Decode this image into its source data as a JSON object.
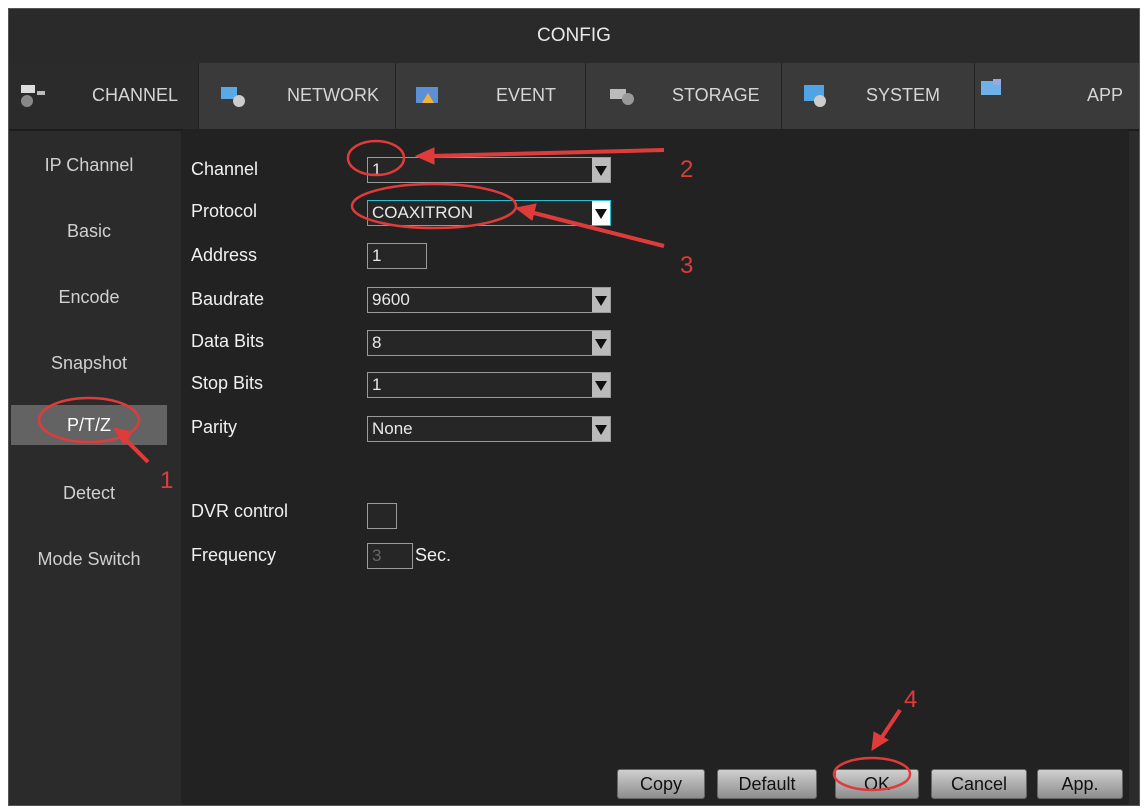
{
  "window": {
    "title": "CONFIG"
  },
  "tabs": [
    {
      "label": "CHANNEL",
      "icon": "channel-icon"
    },
    {
      "label": "NETWORK",
      "icon": "network-icon"
    },
    {
      "label": "EVENT",
      "icon": "event-icon"
    },
    {
      "label": "STORAGE",
      "icon": "storage-icon"
    },
    {
      "label": "SYSTEM",
      "icon": "system-icon"
    },
    {
      "label": "APP",
      "icon": "app-icon"
    }
  ],
  "sidebar": {
    "items": [
      {
        "label": "IP Channel"
      },
      {
        "label": "Basic"
      },
      {
        "label": "Encode"
      },
      {
        "label": "Snapshot"
      },
      {
        "label": "P/T/Z"
      },
      {
        "label": "Detect"
      },
      {
        "label": "Mode Switch"
      }
    ]
  },
  "form": {
    "channel": {
      "label": "Channel",
      "value": "1"
    },
    "protocol": {
      "label": "Protocol",
      "value": "COAXITRON"
    },
    "address": {
      "label": "Address",
      "value": "1"
    },
    "baudrate": {
      "label": "Baudrate",
      "value": "9600"
    },
    "databits": {
      "label": "Data Bits",
      "value": "8"
    },
    "stopbits": {
      "label": "Stop Bits",
      "value": "1"
    },
    "parity": {
      "label": "Parity",
      "value": "None"
    },
    "dvrcontrol": {
      "label": "DVR control",
      "checked": false
    },
    "frequency": {
      "label": "Frequency",
      "value": "3",
      "unit": "Sec."
    }
  },
  "buttons": {
    "copy": "Copy",
    "default": "Default",
    "ok": "OK",
    "cancel": "Cancel",
    "apply": "App."
  },
  "annotations": {
    "n1": "1",
    "n2": "2",
    "n3": "3",
    "n4": "4"
  },
  "colors": {
    "annotation": "#e03b3b",
    "accent": "#27c1d6"
  }
}
